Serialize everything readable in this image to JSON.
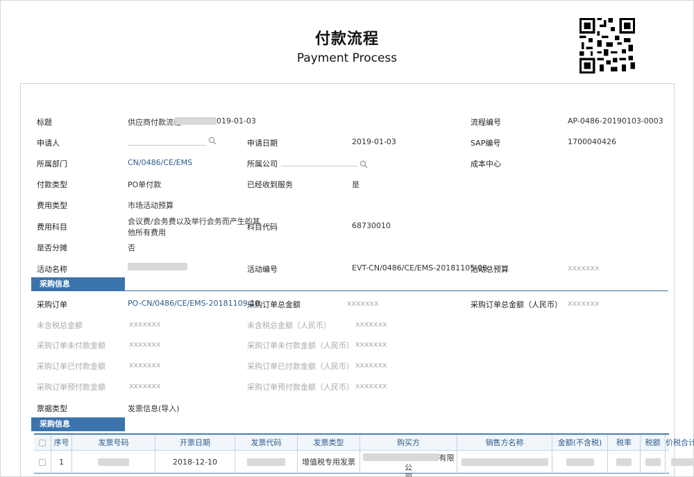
{
  "header": {
    "title_cn": "付款流程",
    "title_en": "Payment Process"
  },
  "form": {
    "title_label": "标题",
    "title_value": "供应商付款流程",
    "title_value_tail": "019-01-03",
    "flow_no_label": "流程编号",
    "flow_no_value": "AP-0486-20190103-0003",
    "applicant_label": "申请人",
    "apply_date_label": "申请日期",
    "apply_date_value": "2019-01-03",
    "sap_label": "SAP编号",
    "sap_value": "1700040426",
    "dept_label": "所属部门",
    "dept_value": "CN/0486/CE/EMS",
    "company_label": "所属公司",
    "cost_center_label": "成本中心",
    "pay_type_label": "付款类型",
    "pay_type_value": "PO单付款",
    "service_label": "已经收到服务",
    "service_value": "是",
    "expense_type_label": "费用类型",
    "expense_type_value": "市场活动预算",
    "expense_subject_label": "费用科目",
    "expense_subject_line1": "会议费/会务费以及举行会务而产生的其",
    "expense_subject_line2": "他所有费用",
    "subject_code_label": "科目代码",
    "subject_code_value": "68730010",
    "split_label": "是否分摊",
    "split_value": "否",
    "activity_name_label": "活动名称",
    "activity_no_label": "活动编号",
    "activity_no_value": "EVT-CN/0486/CE/EMS-20181105-08",
    "activity_budget_label": "活动总预算",
    "activity_budget_value": "xxxxxxx"
  },
  "purchase": {
    "section_title": "采购信息",
    "po_label": "采购订单",
    "po_value": "PO-CN/0486/CE/EMS-20181109-10",
    "po_total_label": "采购订单总金额",
    "po_total_value": "xxxxxxx",
    "po_total_rmb_label": "采购订单总金额（人民币）",
    "po_total_rmb_value": "xxxxxxx",
    "untaxed_total_label": "未含税总金额",
    "untaxed_total_value": "xxxxxxx",
    "untaxed_total_rmb_label": "未含税总金额（人民币）",
    "untaxed_total_rmb_value": "xxxxxxx",
    "unpaid_label": "采购订单未付款金额",
    "unpaid_value": "xxxxxxx",
    "unpaid_rmb_label": "采购订单未付款金额（人民币）",
    "unpaid_rmb_value": "xxxxxxx",
    "paid_label": "采购订单已付款金额",
    "paid_value": "xxxxxxx",
    "paid_rmb_label": "采购订单已付款金额（人民币）",
    "paid_rmb_value": "xxxxxxx",
    "prepaid_label": "采购订单预付款金额",
    "prepaid_value": "xxxxxxx",
    "prepaid_rmb_label": "采购订单预付款金额（人民币）",
    "prepaid_rmb_value": "xxxxxxx",
    "bill_type_label": "票据类型",
    "bill_type_value": "发票信息(导入)"
  },
  "invoice": {
    "section_title": "采购信息",
    "columns": [
      "序号",
      "发票号码",
      "开票日期",
      "发票代码",
      "发票类型",
      "购买方",
      "销售方名称",
      "金额(不含税)",
      "税率",
      "税额",
      "价税合计"
    ],
    "row": {
      "index": "1",
      "date": "2018-12-10",
      "type": "增值税专用发票",
      "buyer_tail": "有限公",
      "buyer_wrap": "司"
    }
  },
  "colors": {
    "accent": "#3b74ad",
    "link": "#2d5a8c",
    "muted": "#aaaaaa"
  }
}
